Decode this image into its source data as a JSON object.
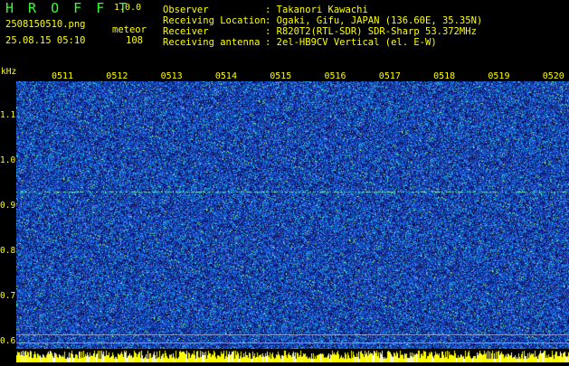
{
  "header": {
    "app_title": "H R O F F T",
    "version": "1.0.0",
    "filename": "2508150510.png",
    "mode": "meteor",
    "datetime": "25.08.15 05:10",
    "count": "108",
    "info": [
      {
        "label": "Observer",
        "value": ": Takanori Kawachi"
      },
      {
        "label": "Receiving Location",
        "value": ": Ogaki, Gifu, JAPAN (136.60E, 35.35N)"
      },
      {
        "label": "Receiver",
        "value": ": R820T2(RTL-SDR) SDR-Sharp 53.372MHz"
      },
      {
        "label": "Receiving antenna",
        "value": ": 2el-HB9CV Vertical (el. E-W)"
      }
    ]
  },
  "axis": {
    "unit": "kHz",
    "y_ticks": [
      "1.1",
      "1.0",
      "0.9",
      "0.8",
      "0.7",
      "0.6"
    ],
    "x_ticks": [
      "0511",
      "0512",
      "0513",
      "0514",
      "0515",
      "0516",
      "0517",
      "0518",
      "0519",
      "0520"
    ]
  },
  "colors": {
    "background": "#000000",
    "label": "#ffff00",
    "info_text": "#00ffff",
    "noise_base": "#1f37a6"
  }
}
